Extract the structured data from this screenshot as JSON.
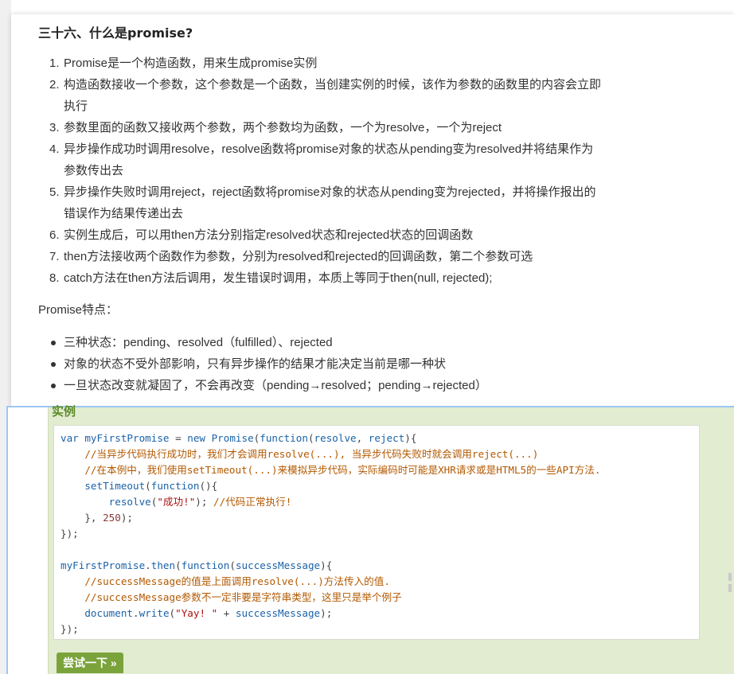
{
  "section": {
    "title": "三十六、什么是promise?"
  },
  "steps": [
    {
      "num": "1.",
      "lines": [
        "Promise是一个构造函数，用来生成promise实例"
      ]
    },
    {
      "num": "2.",
      "lines": [
        "构造函数接收一个参数，这个参数是一个函数，当创建实例的时候，该作为参数的函数里的内容会立即",
        "执行"
      ]
    },
    {
      "num": "3.",
      "lines": [
        "参数里面的函数又接收两个参数，两个参数均为函数，一个为resolve，一个为reject"
      ]
    },
    {
      "num": "4.",
      "lines": [
        "异步操作成功时调用resolve，resolve函数将promise对象的状态从pending变为resolved并将结果作为",
        "参数传出去"
      ]
    },
    {
      "num": "5.",
      "lines": [
        "异步操作失败时调用reject，reject函数将promise对象的状态从pending变为rejected，并将操作报出的",
        "错误作为结果传递出去"
      ]
    },
    {
      "num": "6.",
      "lines": [
        "实例生成后，可以用then方法分别指定resolved状态和rejected状态的回调函数"
      ]
    },
    {
      "num": "7.",
      "lines": [
        "then方法接收两个函数作为参数，分别为resolved和rejected的回调函数，第二个参数可选"
      ]
    },
    {
      "num": "8.",
      "lines": [
        "catch方法在then方法后调用，发生错误时调用，本质上等同于then(null, rejected);"
      ]
    }
  ],
  "features": {
    "label": "Promise特点：",
    "items": [
      "三种状态：pending、resolved（fulfilled）、rejected",
      "对象的状态不受外部影响，只有异步操作的结果才能决定当前是哪一种状",
      "一旦状态改变就凝固了，不会再改变（pending→resolved；pending→rejected）"
    ]
  },
  "example": {
    "title": "实例",
    "try_button": "尝试一下 »",
    "code_lines": [
      [
        [
          "kw",
          "var "
        ],
        [
          "kw",
          "myFirstPromise"
        ],
        [
          "",
          ""
        ],
        [
          "",
          " = "
        ],
        [
          "kw",
          "new "
        ],
        [
          "kw",
          "Promise"
        ],
        [
          "",
          "("
        ],
        [
          "kw",
          "function"
        ],
        [
          "",
          "("
        ],
        [
          "kw",
          "resolve"
        ],
        [
          "",
          ", "
        ],
        [
          "kw",
          "reject"
        ],
        [
          "",
          "){"
        ]
      ],
      [
        [
          "",
          "    "
        ],
        [
          "cm",
          "//当异步代码执行成功时，我们才会调用resolve(...), 当异步代码失败时就会调用reject(...)"
        ]
      ],
      [
        [
          "",
          "    "
        ],
        [
          "cm",
          "//在本例中，我们使用setTimeout(...)来模拟异步代码，实际编码时可能是XHR请求或是HTML5的一些API方法."
        ]
      ],
      [
        [
          "",
          "    "
        ],
        [
          "kw",
          "setTimeout"
        ],
        [
          "",
          "("
        ],
        [
          "kw",
          "function"
        ],
        [
          "",
          "(){"
        ]
      ],
      [
        [
          "",
          "        "
        ],
        [
          "kw",
          "resolve"
        ],
        [
          "",
          "("
        ],
        [
          "st",
          "\"成功!\""
        ],
        [
          "",
          "); "
        ],
        [
          "cm",
          "//代码正常执行!"
        ]
      ],
      [
        [
          "",
          "    }, "
        ],
        [
          "nm",
          "250"
        ],
        [
          "",
          ");"
        ]
      ],
      [
        [
          "",
          "});"
        ]
      ],
      [
        [
          "",
          ""
        ]
      ],
      [
        [
          "kw",
          "myFirstPromise"
        ],
        [
          "",
          "."
        ],
        [
          "kw",
          "then"
        ],
        [
          "",
          "("
        ],
        [
          "kw",
          "function"
        ],
        [
          "",
          "("
        ],
        [
          "kw",
          "successMessage"
        ],
        [
          "",
          "){"
        ]
      ],
      [
        [
          "",
          "    "
        ],
        [
          "cm",
          "//successMessage的值是上面调用resolve(...)方法传入的值."
        ]
      ],
      [
        [
          "",
          "    "
        ],
        [
          "cm",
          "//successMessage参数不一定非要是字符串类型，这里只是举个例子"
        ]
      ],
      [
        [
          "",
          "    "
        ],
        [
          "kw",
          "document"
        ],
        [
          "",
          "."
        ],
        [
          "kw",
          "write"
        ],
        [
          "",
          "("
        ],
        [
          "st",
          "\"Yay! \""
        ],
        [
          "",
          " + "
        ],
        [
          "kw",
          "successMessage"
        ],
        [
          "",
          ");"
        ]
      ],
      [
        [
          "",
          "});"
        ]
      ]
    ]
  },
  "colors": {
    "keyword": "#1a62a8",
    "comment": "#b35900",
    "string": "#a11",
    "example_bg": "#e2ecd0",
    "button_bg": "#7aa33b"
  }
}
